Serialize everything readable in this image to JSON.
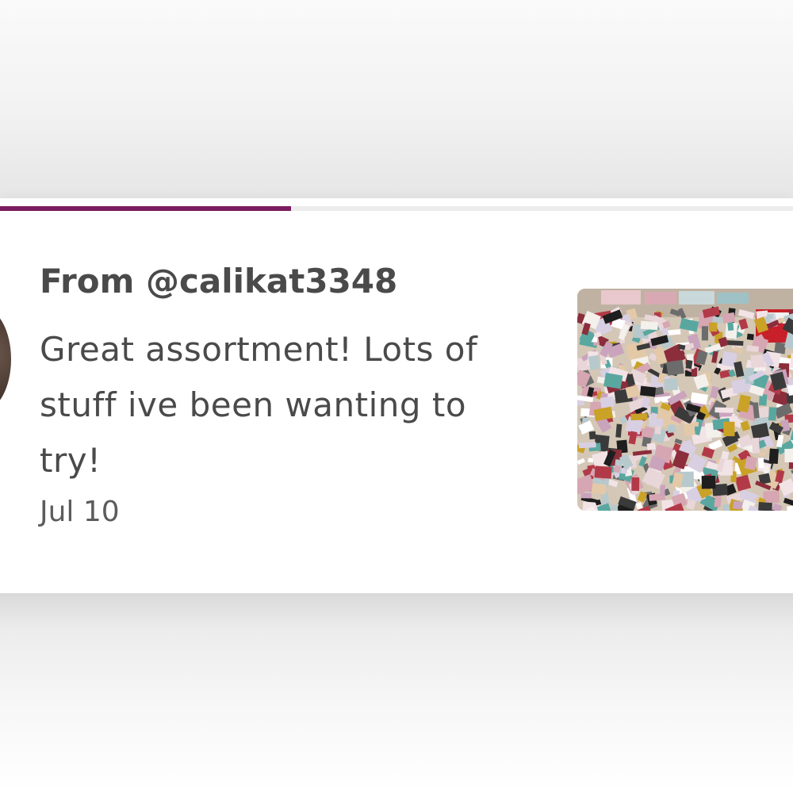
{
  "review": {
    "from": "From @calikat3348",
    "text": "Great assortment! Lots of stuff ive been wanting to try!",
    "date": "Jul 10",
    "progress_fraction": 0.367
  },
  "colors": {
    "accent": "#7a1c5f",
    "text": "#4a4a4a",
    "muted": "#5c5c5c"
  },
  "icons": {
    "avatar": "user-avatar",
    "photo": "review-photo-thumbnail"
  }
}
